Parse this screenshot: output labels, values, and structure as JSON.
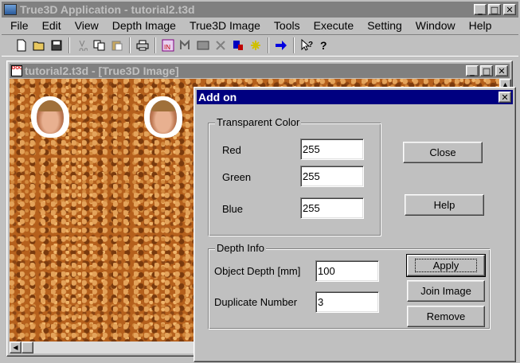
{
  "app": {
    "title": "True3D Application - tutorial2.t3d",
    "menu": [
      "File",
      "Edit",
      "View",
      "Depth Image",
      "True3D Image",
      "Tools",
      "Execute",
      "Setting",
      "Window",
      "Help"
    ]
  },
  "toolbar": {
    "icons": [
      "new-file-icon",
      "open-folder-icon",
      "save-icon",
      "cut-icon",
      "copy-icon",
      "paste-icon",
      "print-icon",
      "import-in-icon",
      "depth-export-icon",
      "gray-image-icon",
      "depth-map-icon",
      "blue-square-icon",
      "yellow-transform-icon",
      "blue-arrow-icon",
      "context-help-icon",
      "help-icon"
    ]
  },
  "child": {
    "title": "tutorial2.t3d - [True3D Image]"
  },
  "dialog": {
    "title": "Add on",
    "transparent": {
      "caption": "Transparent Color",
      "red_label": "Red",
      "red_value": "255",
      "green_label": "Green",
      "green_value": "255",
      "blue_label": "Blue",
      "blue_value": "255"
    },
    "depth": {
      "caption": "Depth Info",
      "object_depth_label": "Object Depth [mm]",
      "object_depth_value": "100",
      "duplicate_label": "Duplicate Number",
      "duplicate_value": "3"
    },
    "buttons": {
      "close": "Close",
      "help": "Help",
      "apply": "Apply",
      "join_image": "Join Image",
      "remove": "Remove"
    }
  },
  "colors": {
    "inactive_caption": "#808080",
    "active_caption": "#000080",
    "face_color": "#c0c0c0",
    "cork_texture": "#b5601c"
  }
}
